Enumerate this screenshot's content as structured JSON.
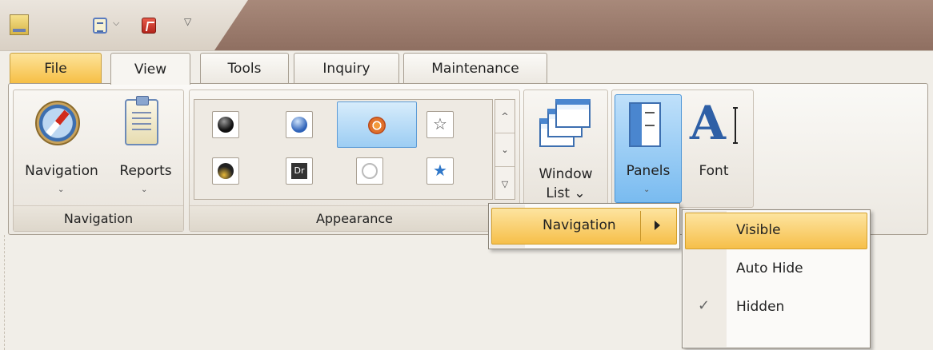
{
  "quick_access": {
    "app_icon": "app-logo-icon",
    "buttons": [
      "clipboard-icon",
      "acrobat-icon"
    ],
    "dropdown_glyph": "⌵",
    "customize_glyph": "▽"
  },
  "tabs": [
    {
      "label": "File"
    },
    {
      "label": "View"
    },
    {
      "label": "Tools"
    },
    {
      "label": "Inquiry"
    },
    {
      "label": "Maintenance"
    }
  ],
  "active_tab": "View",
  "ribbon": {
    "navigation_group": {
      "caption": "Navigation",
      "buttons": [
        {
          "label": "Navigation",
          "icon": "compass-icon",
          "dropdown": "⌄"
        },
        {
          "label": "Reports",
          "icon": "clipboard-report-icon",
          "dropdown": "⌄"
        }
      ]
    },
    "appearance_group": {
      "caption": "Appearance",
      "gallery_items": [
        {
          "icon": "black-orb-icon",
          "dr_text": ""
        },
        {
          "icon": "blue-orb-icon",
          "dr_text": ""
        },
        {
          "icon": "orange-swirl-icon",
          "selected": true,
          "dr_text": ""
        },
        {
          "icon": "star-outline-icon",
          "dr_text": ""
        },
        {
          "icon": "gold-orb-icon",
          "dr_text": ""
        },
        {
          "icon": "dr-icon",
          "dr_text": "Dr"
        },
        {
          "icon": "cloud-outline-icon",
          "dr_text": ""
        },
        {
          "icon": "blue-star-icon",
          "dr_text": ""
        }
      ],
      "scroll_glyphs": [
        "^",
        "⌄",
        "▽"
      ]
    },
    "window_list": {
      "label_line1": "Window",
      "label_line2": "List ⌄"
    },
    "panels": {
      "label": "Panels",
      "dropdown": "⌄",
      "pressed": true
    },
    "font": {
      "label": "Font",
      "glyph": "A"
    }
  },
  "menus": {
    "panels_menu": {
      "item": "Navigation",
      "has_submenu": true
    },
    "navigation_submenu": {
      "items": [
        {
          "label": "Visible",
          "highlighted": true,
          "checked": false
        },
        {
          "label": "Auto Hide",
          "highlighted": false,
          "checked": false
        },
        {
          "label": "Hidden",
          "highlighted": false,
          "checked": true
        }
      ],
      "check_glyph": "✓"
    }
  },
  "colors": {
    "titlebar": "#9b7d6f",
    "file_tab": "#f6bf45",
    "highlight": "#f6bf49",
    "panels_pressed": "#79bbf0",
    "icon_blue": "#2e5fa6"
  }
}
